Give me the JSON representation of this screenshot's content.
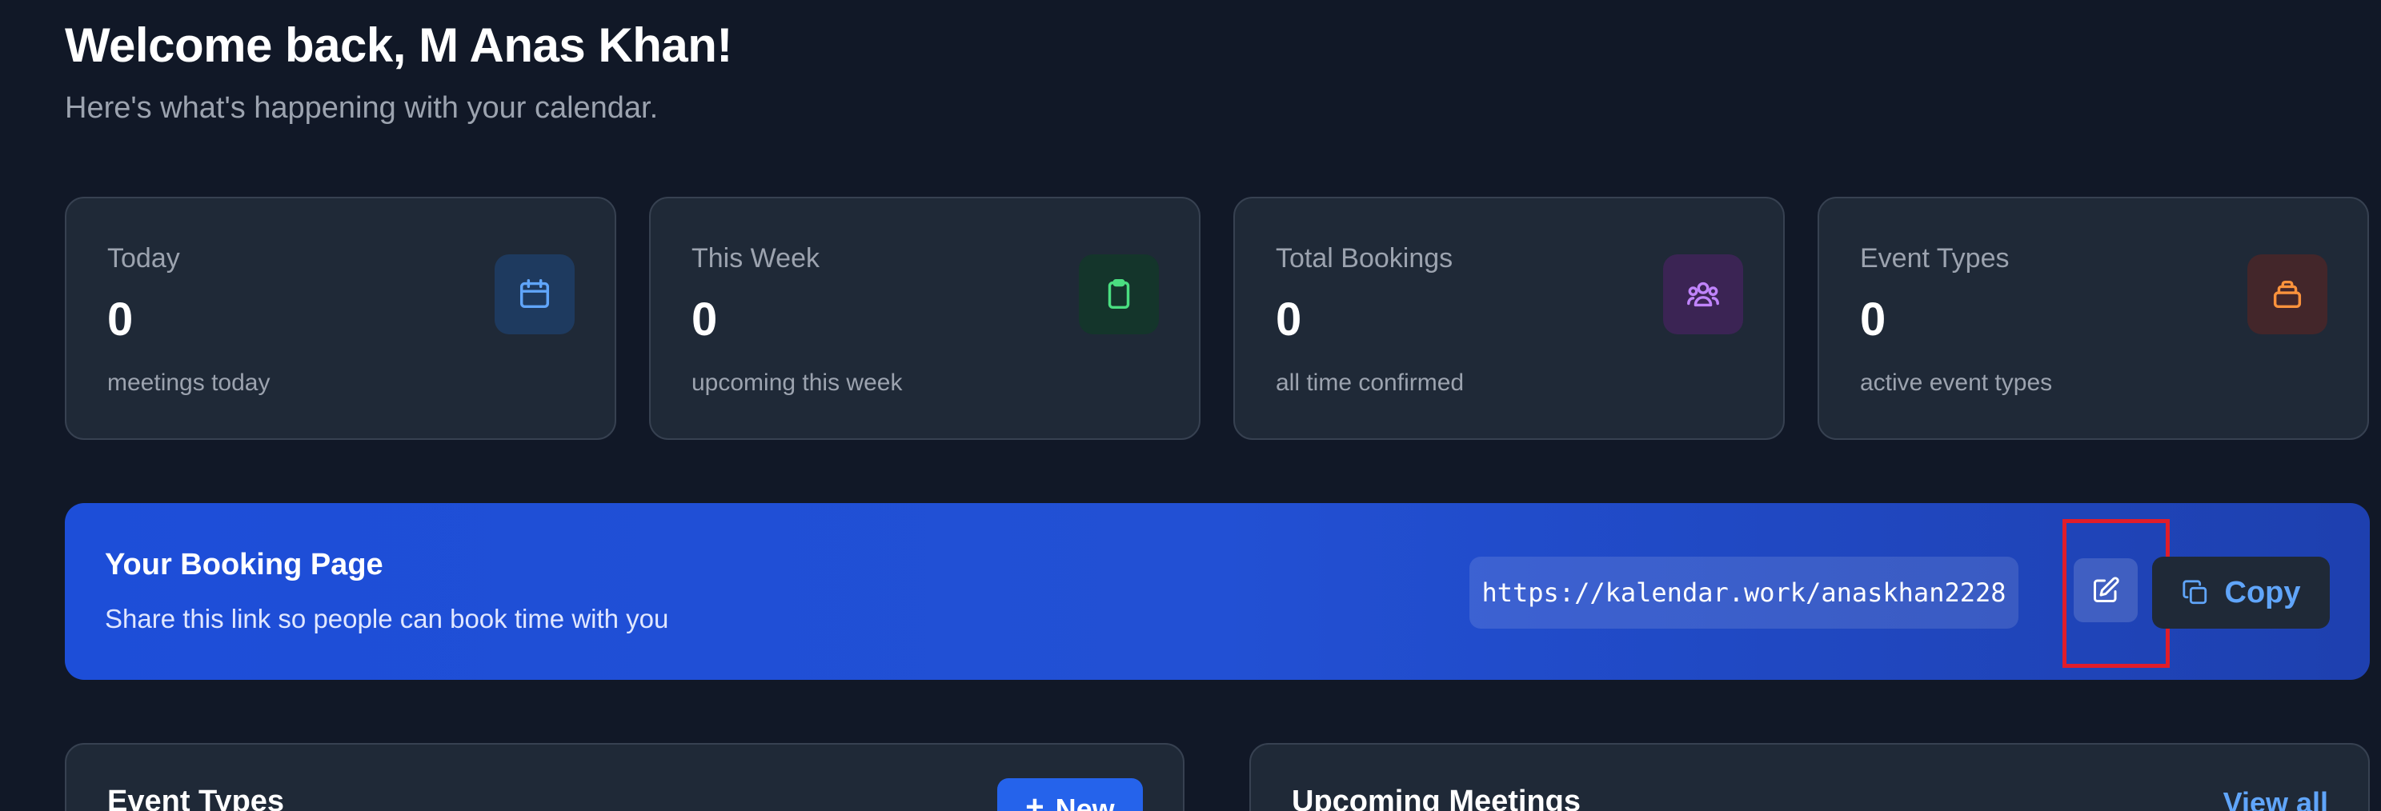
{
  "header": {
    "title": "Welcome back, M Anas Khan!",
    "subtitle": "Here's what's happening with your calendar."
  },
  "stats": [
    {
      "label": "Today",
      "value": "0",
      "sub": "meetings today",
      "icon": "calendar-icon",
      "color": "#60a5fa",
      "bg": "#1e3a5f"
    },
    {
      "label": "This Week",
      "value": "0",
      "sub": "upcoming this week",
      "icon": "clipboard-icon",
      "color": "#4ade80",
      "bg": "#14352b"
    },
    {
      "label": "Total Bookings",
      "value": "0",
      "sub": "all time confirmed",
      "icon": "users-icon",
      "color": "#c084fc",
      "bg": "#3b2454"
    },
    {
      "label": "Event Types",
      "value": "0",
      "sub": "active event types",
      "icon": "layers-icon",
      "color": "#fb923c",
      "bg": "#43262a"
    }
  ],
  "booking": {
    "title": "Your Booking Page",
    "description": "Share this link so people can book time with you",
    "url": "https://kalendar.work/anaskhan2228",
    "copy_label": "Copy"
  },
  "event_types_panel": {
    "title": "Event Types",
    "new_label": "New"
  },
  "meetings_panel": {
    "title": "Upcoming Meetings",
    "view_all_label": "View all"
  },
  "colors": {
    "background": "#111827",
    "card": "#1f2937",
    "accent": "#2563eb",
    "link": "#60a5fa",
    "highlight": "#e11d2a"
  }
}
